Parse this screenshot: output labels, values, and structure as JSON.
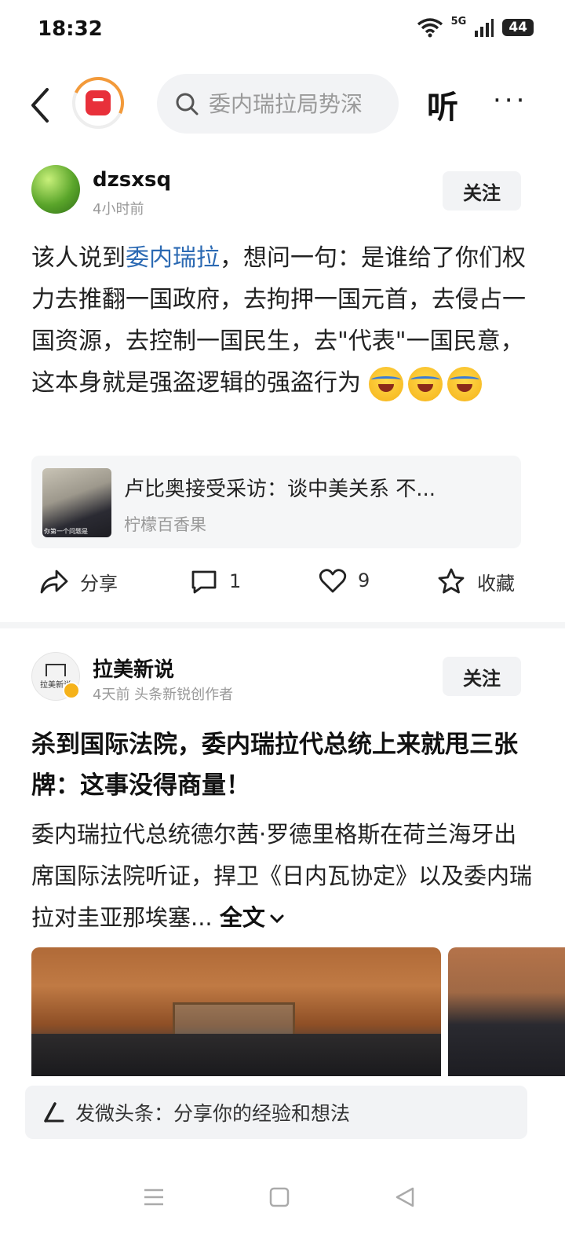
{
  "status_bar": {
    "time": "18:32",
    "network": "5G",
    "battery": "44"
  },
  "top_bar": {
    "search_placeholder": "委内瑞拉局势深",
    "listen_label": "听",
    "more_label": "···"
  },
  "post1": {
    "username": "dzsxsq",
    "time": "4小时前",
    "follow_label": "关注",
    "content_before": "该人说到",
    "content_link": "委内瑞拉",
    "content_after": "，想问一句：是谁给了你们权力去推翻一国政府，去拘押一国元首，去侵占一国资源，去控制一国民生，去\"代表\"一国民意，这本身就是强盗逻辑的强盗行为",
    "quoted": {
      "title": "卢比奥接受采访：谈中美关系 不...",
      "source": "柠檬百香果",
      "thumb_caption": "你第一个问题是"
    },
    "actions": {
      "share": "分享",
      "comments": "1",
      "likes": "9",
      "favorite": "收藏"
    }
  },
  "post2": {
    "username": "拉美新说",
    "meta": "4天前  头条新锐创作者",
    "avatar_text": "拉美新说",
    "follow_label": "关注",
    "headline": "杀到国际法院，委内瑞拉代总统上来就甩三张牌：这事没得商量！",
    "summary": "委内瑞拉代总统德尔茜·罗德里格斯在荷兰海牙出席国际法院听证，捍卫《日内瓦协定》以及委内瑞拉对圭亚那埃塞...",
    "full_text_label": "全文"
  },
  "compose": {
    "placeholder": "发微头条：分享你的经验和想法"
  }
}
